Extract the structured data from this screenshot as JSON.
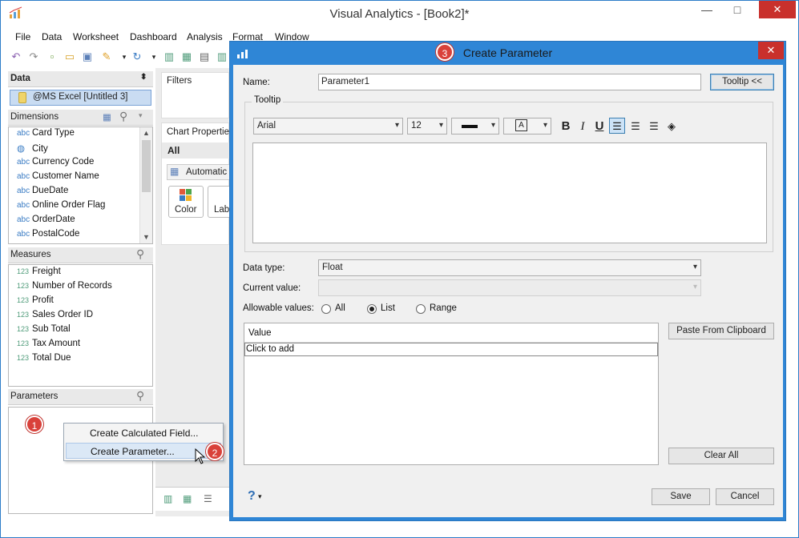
{
  "app": {
    "title": "Visual Analytics - [Book2]*"
  },
  "menu": [
    "File",
    "Data",
    "Worksheet",
    "Dashboard",
    "Analysis",
    "Format",
    "Window"
  ],
  "left_panel": {
    "data_header": "Data",
    "datasource": "@MS Excel [Untitled 3]",
    "dimensions_header": "Dimensions",
    "dimensions": [
      {
        "type": "abc",
        "name": "Card Type"
      },
      {
        "type": "globe",
        "name": "City"
      },
      {
        "type": "abc",
        "name": "Currency Code"
      },
      {
        "type": "abc",
        "name": "Customer Name"
      },
      {
        "type": "abc",
        "name": "DueDate"
      },
      {
        "type": "abc",
        "name": "Online Order Flag"
      },
      {
        "type": "abc",
        "name": "OrderDate"
      },
      {
        "type": "abc",
        "name": "PostalCode"
      }
    ],
    "measures_header": "Measures",
    "measures": [
      {
        "type": "123",
        "name": "Freight"
      },
      {
        "type": "123",
        "name": "Number of Records"
      },
      {
        "type": "123",
        "name": "Profit"
      },
      {
        "type": "123",
        "name": "Sales Order ID"
      },
      {
        "type": "123",
        "name": "Sub Total"
      },
      {
        "type": "123",
        "name": "Tax Amount"
      },
      {
        "type": "123",
        "name": "Total Due"
      }
    ],
    "parameters_header": "Parameters"
  },
  "shelf": {
    "filters": "Filters",
    "chart_properties": "Chart Properties",
    "all": "All",
    "automatic": "Automatic",
    "color": "Color",
    "label": "Lab"
  },
  "context_menu": {
    "create_calc": "Create Calculated Field...",
    "create_param": "Create Parameter..."
  },
  "badges": {
    "one": "1",
    "two": "2",
    "three": "3"
  },
  "dialog": {
    "title": "Create Parameter",
    "name_label": "Name:",
    "name_value": "Parameter1",
    "tooltip_button": "Tooltip <<",
    "tooltip_group": "Tooltip",
    "font": "Arial",
    "font_size": "12",
    "bold": "B",
    "italic": "I",
    "underline": "U",
    "data_type_label": "Data type:",
    "data_type_value": "Float",
    "current_value_label": "Current value:",
    "current_value": "",
    "allowable_label": "Allowable values:",
    "allowable_options": [
      "All",
      "List",
      "Range"
    ],
    "allowable_selected": "List",
    "value_header": "Value",
    "click_to_add": "Click to add",
    "paste_button": "Paste From Clipboard",
    "clear_button": "Clear All",
    "help": "?",
    "save": "Save",
    "cancel": "Cancel"
  },
  "colors": {
    "accent": "#2f86d6",
    "badge": "#d9413a",
    "close": "#c9302c"
  }
}
